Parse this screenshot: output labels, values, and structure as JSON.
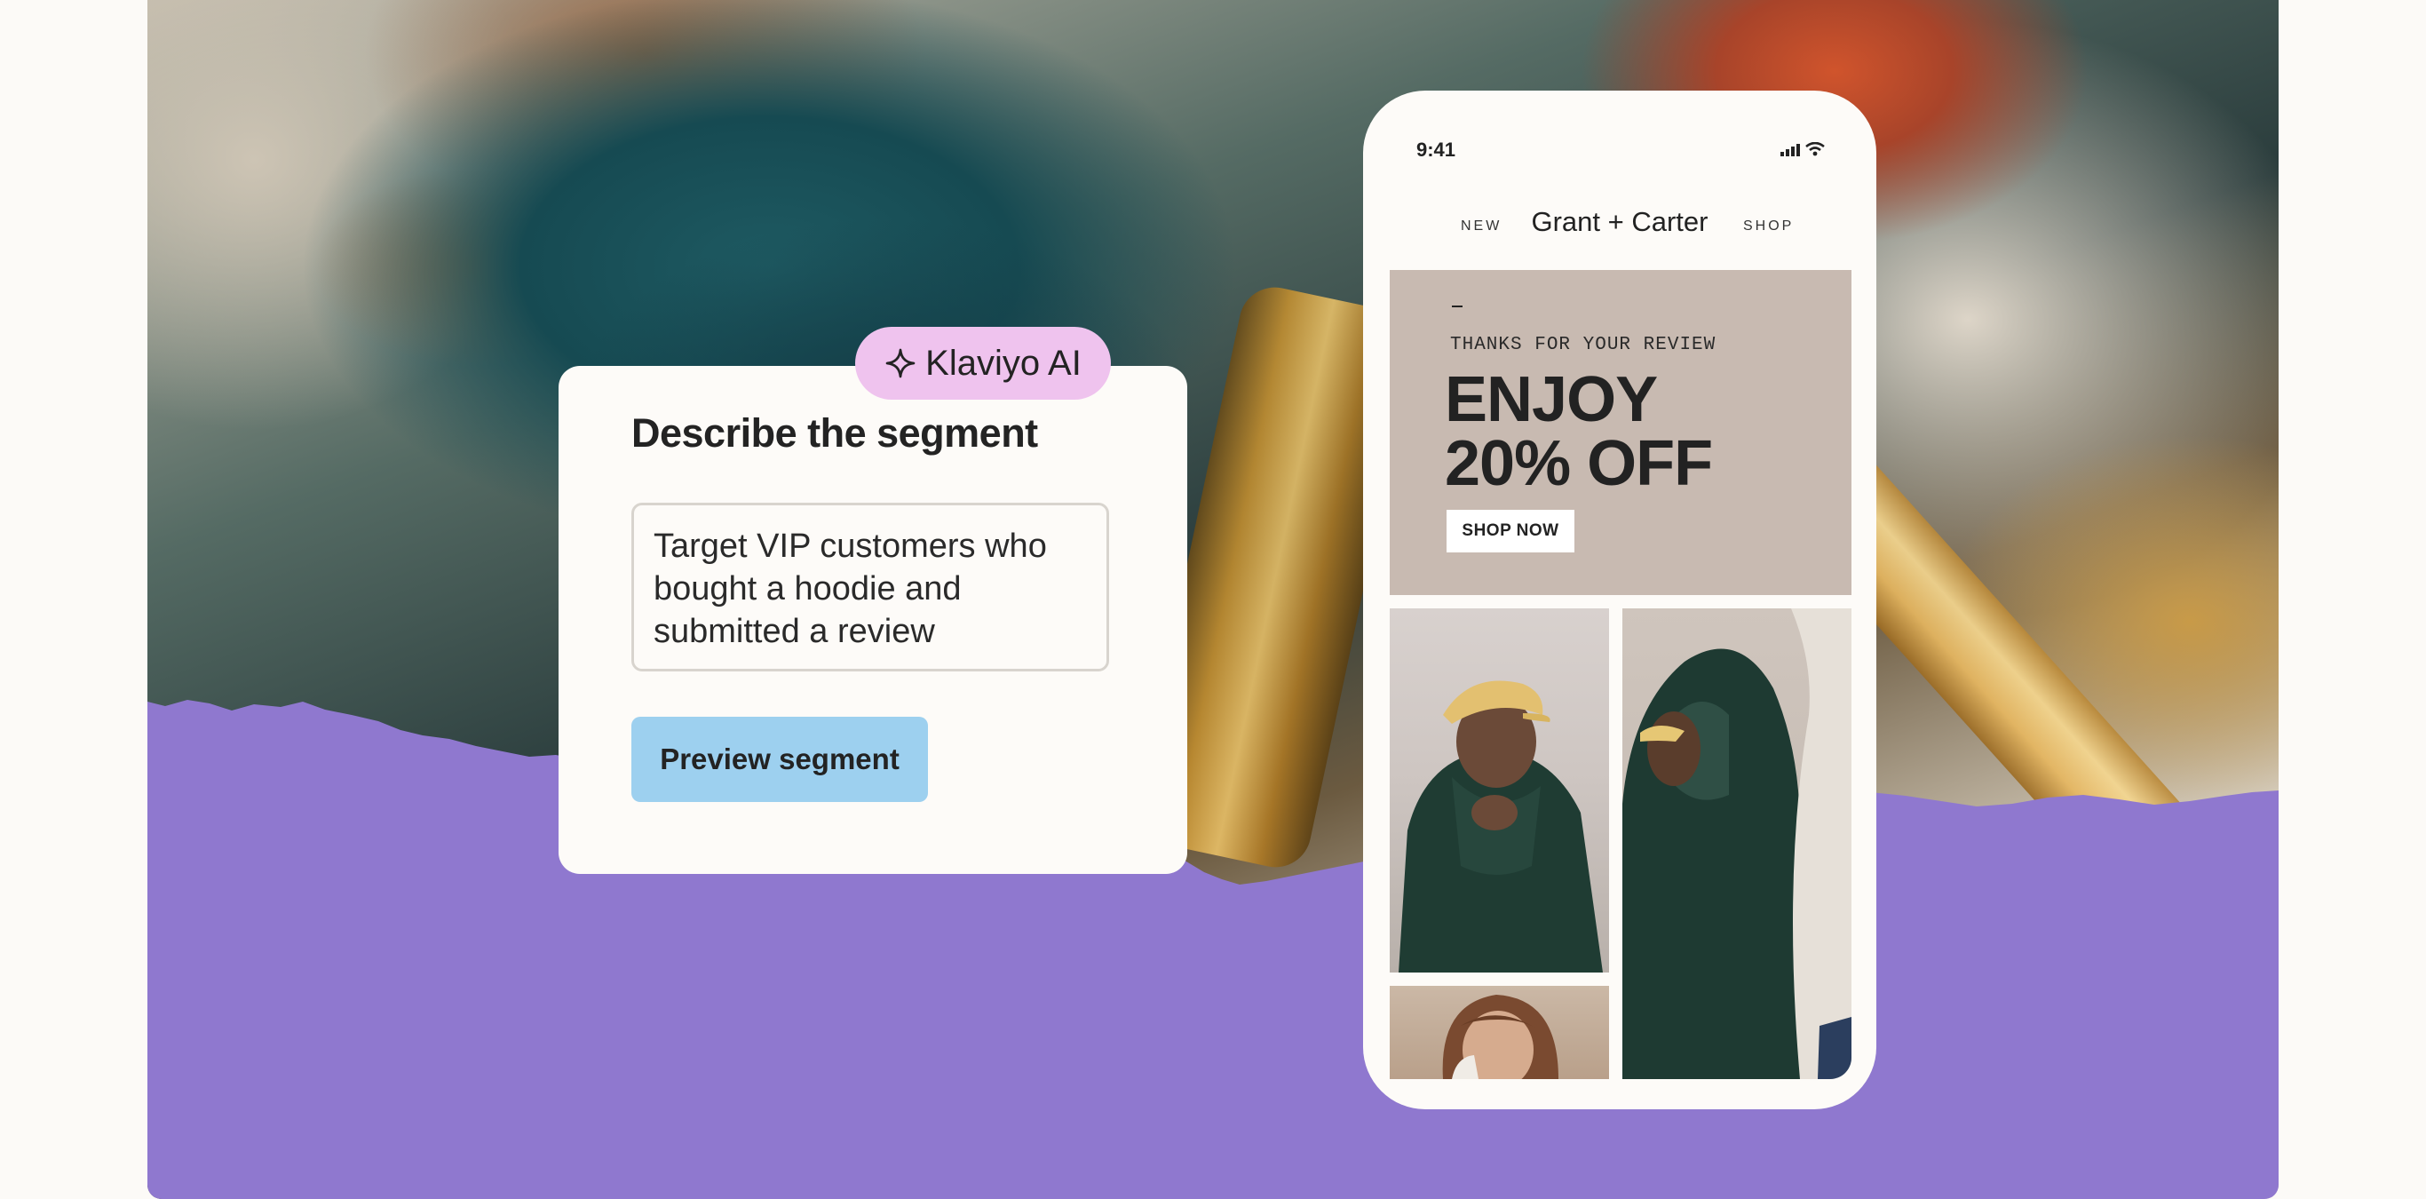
{
  "ai_badge": {
    "label": "Klaviyo AI",
    "icon": "sparkle-icon"
  },
  "segment_card": {
    "title": "Describe the segment",
    "prompt_value": "Target VIP customers who bought a hoodie and submitted a review",
    "preview_button": "Preview segment"
  },
  "phone": {
    "status_time": "9:41",
    "status_icons": [
      "signal-icon",
      "wifi-icon"
    ],
    "nav": {
      "left": "NEW",
      "brand": "Grant + Carter",
      "right": "SHOP"
    },
    "hero": {
      "dash": "–",
      "kicker": "THANKS FOR YOUR REVIEW",
      "headline_line1": "ENJOY",
      "headline_line2": "20% OFF",
      "cta": "SHOP NOW"
    },
    "product_images": [
      "model-yellow-cap-hoodie-photo",
      "model-hooded-profile-photo",
      "model-woman-portrait-photo"
    ]
  },
  "colors": {
    "background": "#fcfaf7",
    "purple": "#8f78cf",
    "ai_badge": "#efc3ee",
    "preview_button": "#9dd0ef",
    "hero": "#c8bab1",
    "hoodie_green": "#1f3c33"
  }
}
